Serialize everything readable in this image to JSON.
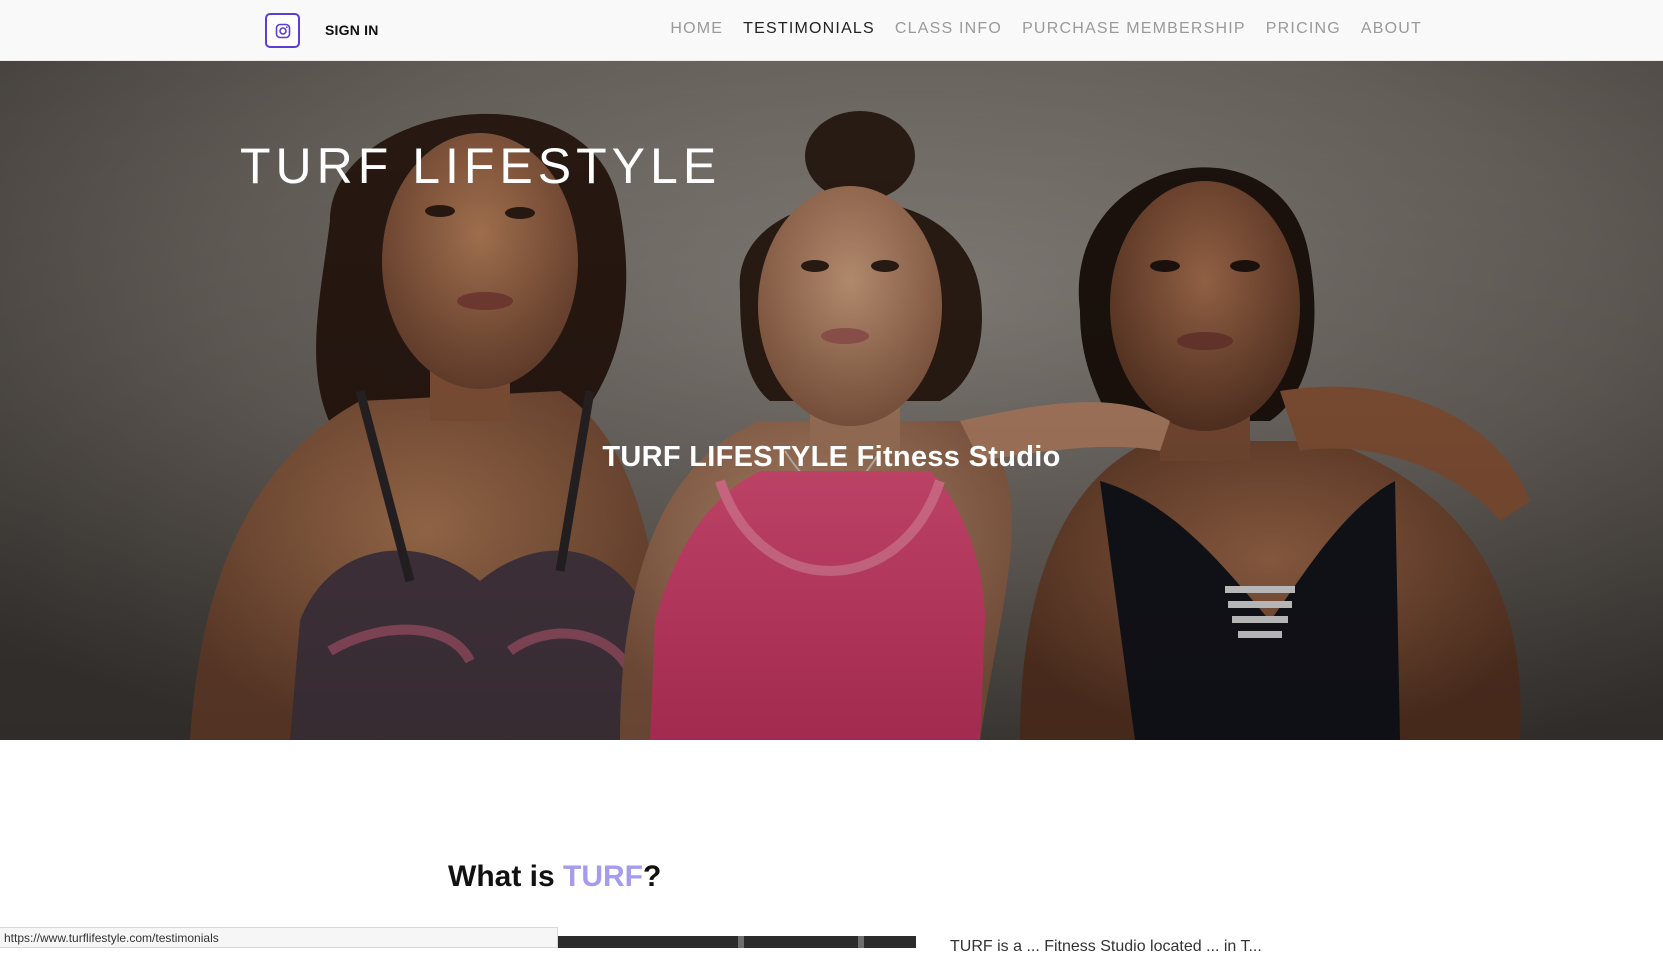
{
  "header": {
    "signin_label": "SIGN IN",
    "nav": [
      {
        "label": "HOME"
      },
      {
        "label": "TESTIMONIALS"
      },
      {
        "label": "CLASS INFO"
      },
      {
        "label": "PURCHASE MEMBERSHIP"
      },
      {
        "label": "PRICING"
      },
      {
        "label": "ABOUT"
      }
    ],
    "active_nav": "TESTIMONIALS",
    "instagram_icon": "instagram-icon",
    "accent_color": "#5b3fd0"
  },
  "hero": {
    "brand": "TURF LIFESTYLE",
    "tagline": "TURF LIFESTYLE Fitness Studio",
    "image": "three-women-in-sports-bras-photo"
  },
  "section": {
    "title_prefix": "What is ",
    "title_accent": "TURF",
    "title_suffix": "?",
    "accent_color": "#a59cf0",
    "intro_snippet": "TURF is a ... Fitness Studio located ... in T..."
  },
  "status_bar": {
    "url": "https://www.turflifestyle.com/testimonials"
  }
}
